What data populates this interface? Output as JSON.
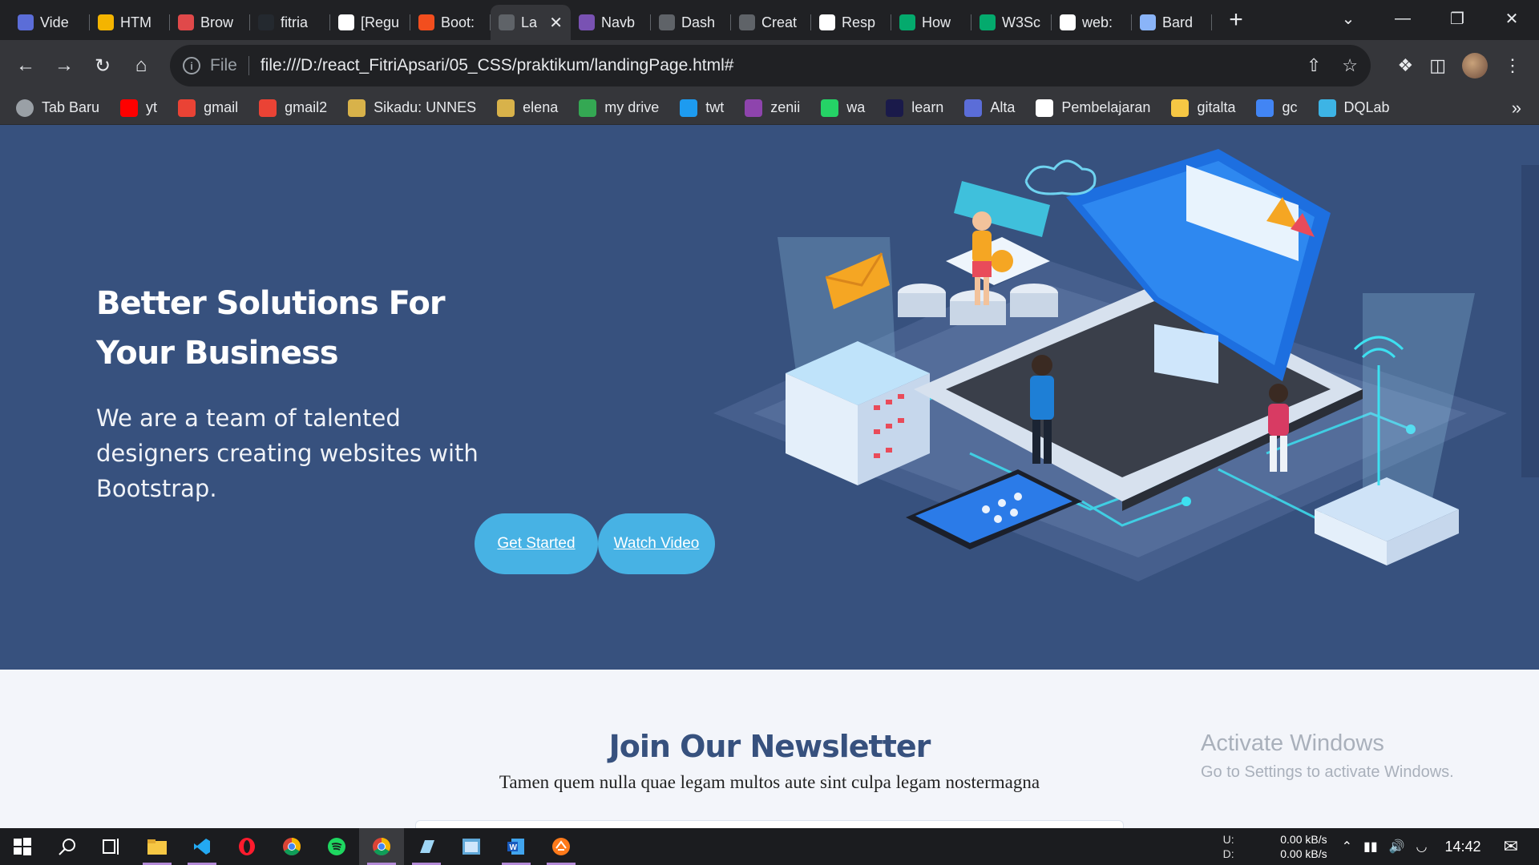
{
  "browser": {
    "tabs": [
      {
        "label": "Vide",
        "icon": "video-icon",
        "color": "#5b6dd8"
      },
      {
        "label": "HTM",
        "icon": "slides-icon",
        "color": "#f4b400"
      },
      {
        "label": "Brow",
        "icon": "brow-icon",
        "color": "#e0494a"
      },
      {
        "label": "fitria",
        "icon": "github-icon",
        "color": "#24292f"
      },
      {
        "label": "[Regu",
        "icon": "notion-icon",
        "color": "#ffffff"
      },
      {
        "label": "Boot:",
        "icon": "figma-icon",
        "color": "#f24e1e"
      },
      {
        "label": "La",
        "icon": "globe-icon",
        "color": "#5f6368"
      },
      {
        "label": "Navb",
        "icon": "bootstrap-icon",
        "color": "#7952b3"
      },
      {
        "label": "Dash",
        "icon": "globe-icon",
        "color": "#5f6368"
      },
      {
        "label": "Creat",
        "icon": "globe-icon",
        "color": "#5f6368"
      },
      {
        "label": "Resp",
        "icon": "codepen-icon",
        "color": "#ffffff"
      },
      {
        "label": "How",
        "icon": "w3-icon",
        "color": "#04aa6d"
      },
      {
        "label": "W3Sc",
        "icon": "w3-icon",
        "color": "#04aa6d"
      },
      {
        "label": "web:",
        "icon": "google-icon",
        "color": "#ffffff"
      },
      {
        "label": "Bard",
        "icon": "bard-icon",
        "color": "#8ab4f8"
      }
    ],
    "active_tab_index": 6,
    "address": {
      "scheme_label": "File",
      "url": "file:///D:/react_FitriApsari/05_CSS/praktikum/landingPage.html#"
    },
    "bookmarks": [
      {
        "label": "Tab Baru",
        "icon": "globe-icon",
        "color": "#9aa0a6"
      },
      {
        "label": "yt",
        "icon": "youtube-icon",
        "color": "#ff0000"
      },
      {
        "label": "gmail",
        "icon": "gmail-icon",
        "color": "#ea4335"
      },
      {
        "label": "gmail2",
        "icon": "gmail-icon",
        "color": "#ea4335"
      },
      {
        "label": "Sikadu: UNNES",
        "icon": "unnes-icon",
        "color": "#d8b24a"
      },
      {
        "label": "elena",
        "icon": "unnes-icon",
        "color": "#d8b24a"
      },
      {
        "label": "my drive",
        "icon": "drive-icon",
        "color": "#34a853"
      },
      {
        "label": "twt",
        "icon": "twitter-icon",
        "color": "#1d9bf0"
      },
      {
        "label": "zenii",
        "icon": "zenius-icon",
        "color": "#8e44ad"
      },
      {
        "label": "wa",
        "icon": "whatsapp-icon",
        "color": "#25d366"
      },
      {
        "label": "learn",
        "icon": "learn-icon",
        "color": "#1a1a4a"
      },
      {
        "label": "Alta",
        "icon": "alta-icon",
        "color": "#5b6dd8"
      },
      {
        "label": "Pembelajaran",
        "icon": "notion-icon",
        "color": "#ffffff"
      },
      {
        "label": "gitalta",
        "icon": "folder-icon",
        "color": "#f6c744"
      },
      {
        "label": "gc",
        "icon": "calendar-icon",
        "color": "#4285f4"
      },
      {
        "label": "DQLab",
        "icon": "dqlab-icon",
        "color": "#3db4e5"
      }
    ]
  },
  "page": {
    "hero": {
      "title": "Better Solutions For Your Business",
      "subtitle": "We are a team of talented designers creating websites with Bootstrap.",
      "btn_get_started": "Get Started",
      "btn_watch_video": "Watch Video"
    },
    "newsletter": {
      "title": "Join Our Newsletter",
      "subtitle": "Tamen quem nulla quae legam multos aute sint culpa legam nostermagna"
    },
    "watermark": {
      "line1": "Activate Windows",
      "line2": "Go to Settings to activate Windows."
    }
  },
  "taskbar": {
    "net_up_label": "U:",
    "net_up_value": "0.00 kB/s",
    "net_down_label": "D:",
    "net_down_value": "0.00 kB/s",
    "time": "14:42"
  },
  "colors": {
    "hero_bg": "#37517e",
    "accent": "#47b2e4",
    "newsletter_title": "#37517e"
  }
}
